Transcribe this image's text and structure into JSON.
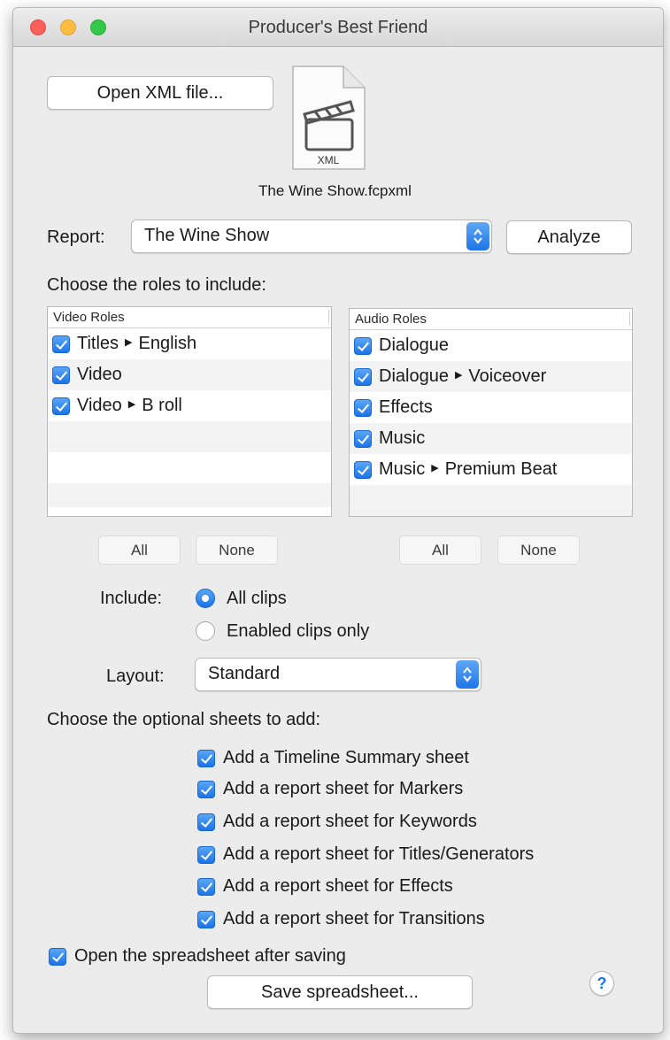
{
  "window": {
    "title": "Producer's Best Friend"
  },
  "open_button": "Open XML file...",
  "file": {
    "icon_label": "XML",
    "name": "The Wine Show.fcpxml"
  },
  "report": {
    "label": "Report:",
    "selected": "The Wine Show",
    "analyze_button": "Analyze"
  },
  "roles": {
    "heading": "Choose the roles to include:",
    "video": {
      "header": "Video Roles",
      "items": [
        {
          "main": "Titles",
          "sub": "English",
          "checked": true
        },
        {
          "main": "Video",
          "sub": "",
          "checked": true
        },
        {
          "main": "Video",
          "sub": "B roll",
          "checked": true
        }
      ]
    },
    "audio": {
      "header": "Audio Roles",
      "items": [
        {
          "main": "Dialogue",
          "sub": "",
          "checked": true
        },
        {
          "main": "Dialogue",
          "sub": "Voiceover",
          "checked": true
        },
        {
          "main": "Effects",
          "sub": "",
          "checked": true
        },
        {
          "main": "Music",
          "sub": "",
          "checked": true
        },
        {
          "main": "Music",
          "sub": "Premium Beat",
          "checked": true
        }
      ]
    },
    "all_label": "All",
    "none_label": "None"
  },
  "include": {
    "label": "Include:",
    "options": [
      "All clips",
      "Enabled clips only"
    ],
    "selected": "All clips"
  },
  "layout": {
    "label": "Layout:",
    "selected": "Standard"
  },
  "sheets": {
    "heading": "Choose the optional sheets to add:",
    "items": [
      "Add a Timeline Summary sheet",
      "Add a report sheet for Markers",
      "Add a report sheet for Keywords",
      "Add a report sheet for Titles/Generators",
      "Add a report sheet for Effects",
      "Add a report sheet for Transitions"
    ]
  },
  "open_after": "Open the spreadsheet after saving",
  "save_button": "Save spreadsheet...",
  "help_glyph": "?",
  "colors": {
    "accent": "#1b74e8",
    "window_bg": "#ececec"
  }
}
